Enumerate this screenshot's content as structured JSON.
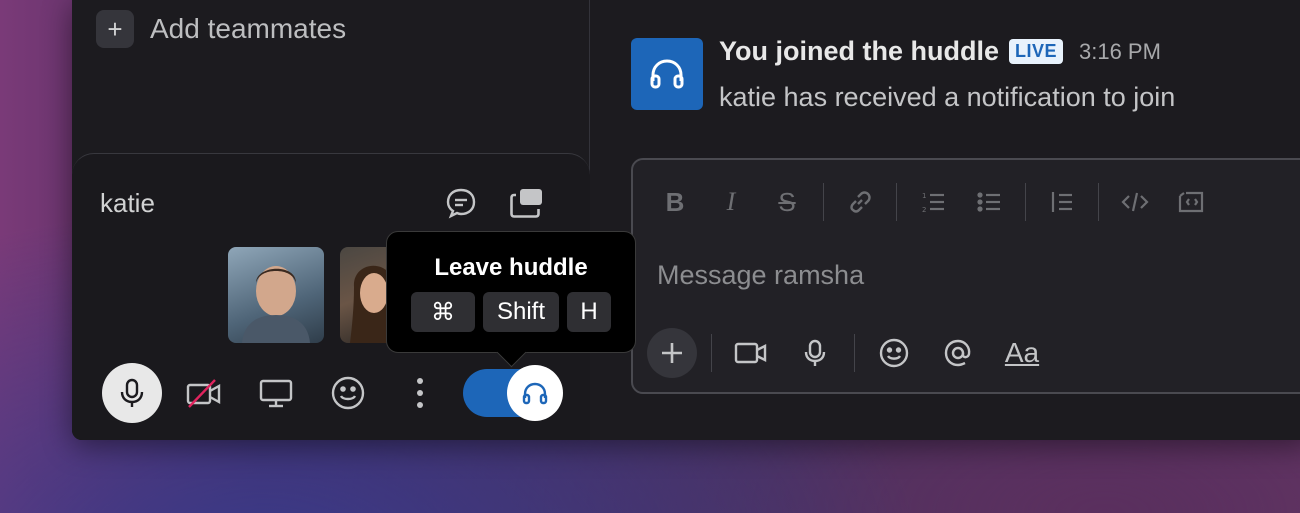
{
  "sidebar": {
    "add_teammates_label": "Add teammates",
    "plus_glyph": "+"
  },
  "huddle": {
    "name": "katie",
    "icons": [
      "thread-icon",
      "popout-window-icon"
    ],
    "controls": [
      "microphone-icon",
      "video-off-icon",
      "screen-share-icon",
      "emoji-icon",
      "more-icon"
    ],
    "toggle_icon": "headphones-icon"
  },
  "tooltip": {
    "title": "Leave huddle",
    "keys": [
      "⌘",
      "Shift",
      "H"
    ]
  },
  "message": {
    "title": "You joined the huddle",
    "badge": "LIVE",
    "time": "3:16 PM",
    "body": "katie has received a notification to join"
  },
  "composer": {
    "placeholder": "Message ramsha",
    "format_buttons": [
      "B",
      "I",
      "S"
    ],
    "text_format_label": "Aa"
  },
  "colors": {
    "accent_blue": "#1d66b8",
    "panel_bg": "#1c1b1f"
  }
}
